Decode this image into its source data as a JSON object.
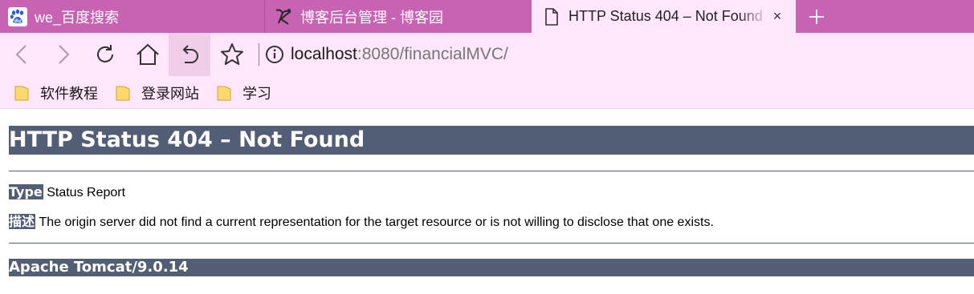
{
  "browser": {
    "tabs": [
      {
        "title": "we_百度搜索",
        "icon": "baidu-paw-icon",
        "active": false
      },
      {
        "title": "博客后台管理 - 博客园",
        "icon": "cnblogs-icon",
        "active": false
      },
      {
        "title": "HTTP Status 404 – Not Found",
        "icon": "document-icon",
        "active": true
      }
    ],
    "close_symbol": "×",
    "address": {
      "host": "localhost",
      "path": ":8080/financialMVC/"
    },
    "bookmarks": [
      {
        "label": "软件教程",
        "icon": "folder-icon"
      },
      {
        "label": "登录网站",
        "icon": "folder-icon"
      },
      {
        "label": "学习",
        "icon": "folder-icon"
      }
    ],
    "colors": {
      "tabstrip": "#c862b2",
      "toolbar": "#ffe6fb",
      "tomcat_header": "#525d76"
    }
  },
  "page": {
    "heading": "HTTP Status 404 – Not Found",
    "type_label": "Type",
    "type_value": "Status Report",
    "desc_label": "描述",
    "desc_value": "The origin server did not find a current representation for the target resource or is not willing to disclose that one exists.",
    "footer": "Apache Tomcat/9.0.14"
  }
}
